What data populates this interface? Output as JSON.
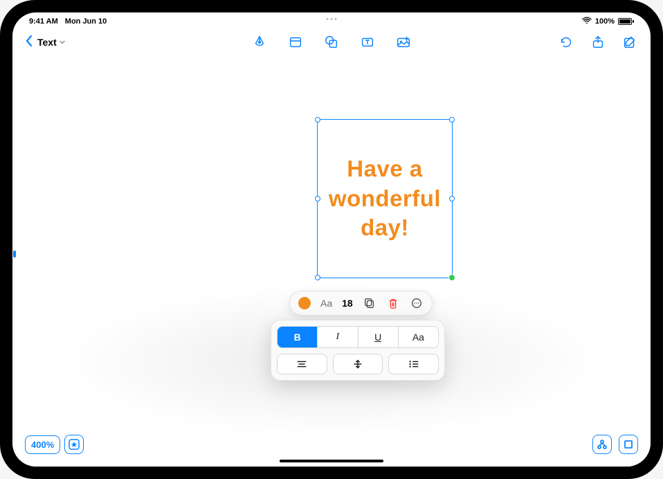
{
  "status": {
    "time": "9:41 AM",
    "date": "Mon Jun 10",
    "battery_pct": "100%"
  },
  "toolbar": {
    "title": "Text"
  },
  "textbox": {
    "content": "Have a wonderful day!",
    "color": "#f28c1e"
  },
  "format_row": {
    "font_label": "Aa",
    "font_size": "18"
  },
  "style_buttons": {
    "bold": "B",
    "italic": "I",
    "underline": "U",
    "case": "Aa"
  },
  "bottom": {
    "zoom": "400%"
  }
}
